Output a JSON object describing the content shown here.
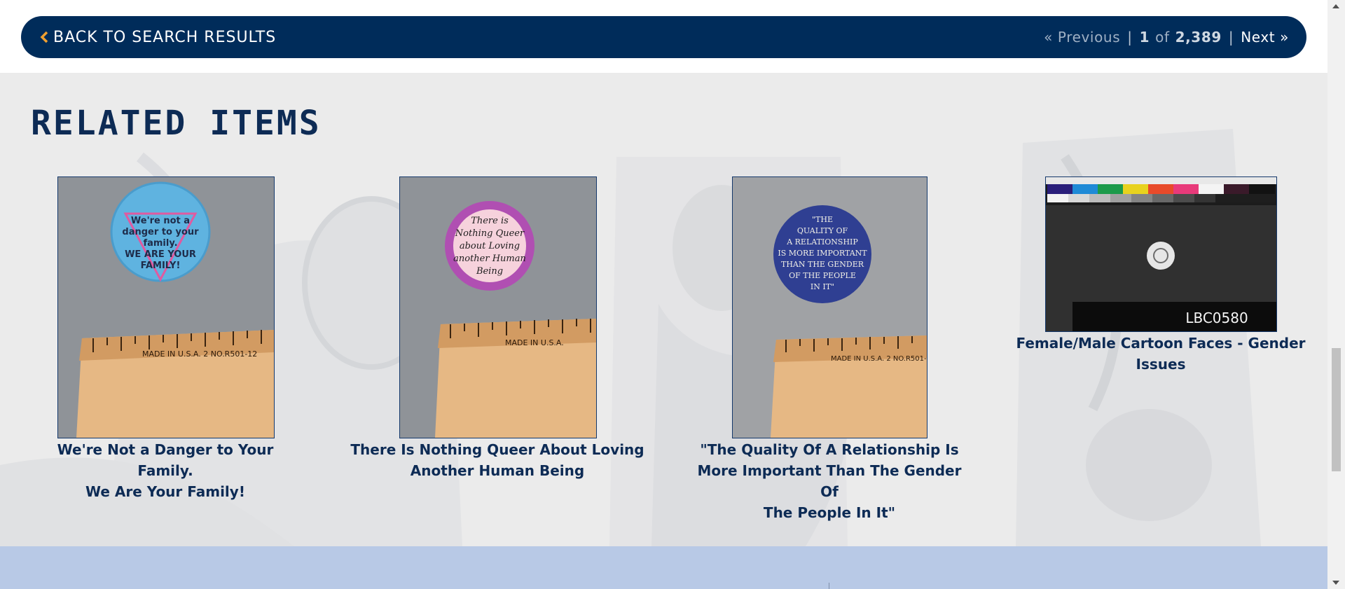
{
  "nav": {
    "back_label": "BACK TO SEARCH RESULTS",
    "prev_label": "« Previous",
    "separator": "|",
    "current": "1",
    "of_label": "of",
    "total": "2,389",
    "next_label": "Next »"
  },
  "related": {
    "heading": "Related Items",
    "items": [
      {
        "caption_line1": "We're Not a Danger to Your Family.",
        "caption_line2": "We Are Your Family!",
        "caption_line3": "",
        "button_text": [
          "We're not a",
          "danger to your",
          "family.",
          "WE ARE YOUR",
          "FAMILY!"
        ],
        "ruler_text": "MADE IN U.S.A.   2   NO.R501-12"
      },
      {
        "caption_line1": "There Is Nothing Queer About Loving",
        "caption_line2": "Another Human Being",
        "caption_line3": "",
        "button_text": [
          "There is",
          "Nothing Queer",
          "about Loving",
          "another Human",
          "Being"
        ],
        "ruler_text": "MADE IN U.S.A."
      },
      {
        "caption_line1": "\"The Quality Of A Relationship Is",
        "caption_line2": "More Important Than The Gender Of",
        "caption_line3": "The People In It\"",
        "button_text": [
          "\"THE",
          "QUALITY OF",
          "A RELATIONSHIP",
          "IS MORE IMPORTANT",
          "THAN THE GENDER",
          "OF THE PEOPLE",
          "IN IT\""
        ],
        "ruler_text": "MADE IN U.S.A.   2   NO.R501-"
      },
      {
        "caption_line1": "Female/Male Cartoon Faces - Gender",
        "caption_line2": "Issues",
        "caption_line3": "",
        "label_text": "LBC0580"
      }
    ]
  },
  "colors": {
    "navy": "#002c5a",
    "heading_navy": "#0d2b55",
    "section_bg": "#ececec",
    "footer_bg": "#b8c9e6"
  },
  "icons": [
    "chevron-left-icon"
  ]
}
